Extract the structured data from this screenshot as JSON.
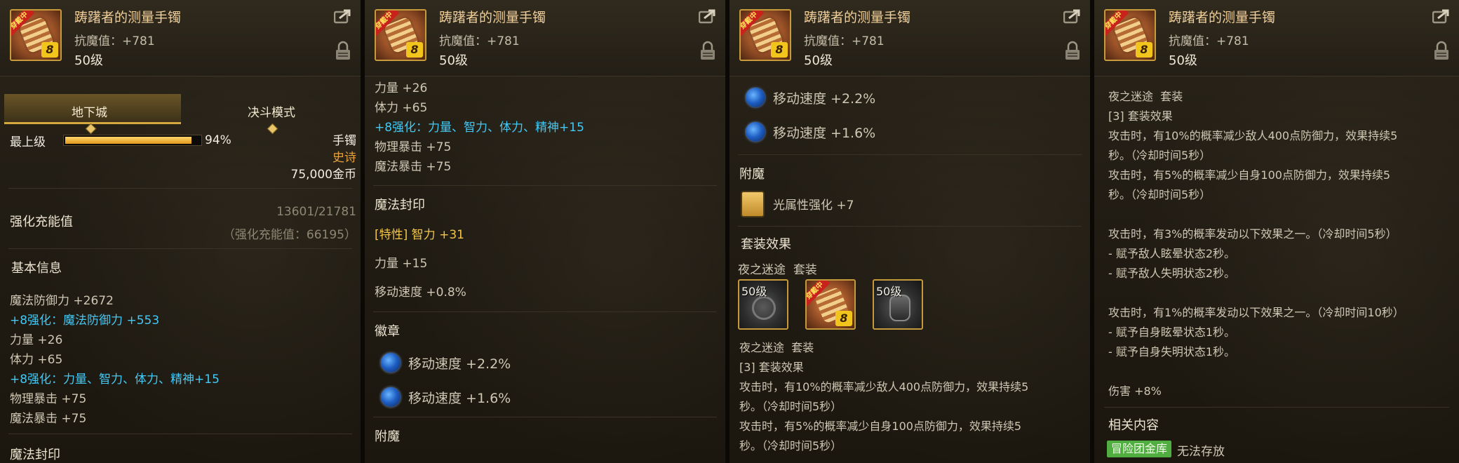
{
  "colors": {
    "accent": "#d6a93f",
    "cyan": "#44c8f4",
    "gold": "#f1c64a",
    "orange": "#e7a23d",
    "badge": "#4fae3f"
  },
  "item": {
    "name": "踌躇者的测量手镯",
    "resist": "抗魔值：+781",
    "level": "50级",
    "ribbon": "穿戴中",
    "enhance": "8",
    "icon": "bracer-icon"
  },
  "p1": {
    "tabs": [
      "地下城",
      "决斗模式"
    ],
    "grade_label": "最上级",
    "grade_percent": 94,
    "grade_percent_text": "94%",
    "type": "手镯",
    "rarity": "史诗",
    "price": "75,000金币",
    "charge_label": "强化充能值",
    "charge_value": "13601/21781",
    "charge_note": "（强化充能值：66195）",
    "basic_title": "基本信息",
    "stats": [
      "魔法防御力 +2672",
      "+8强化：魔法防御力 +553",
      "力量 +26",
      "体力 +65",
      "+8强化：力量、智力、体力、精神+15",
      "物理暴击 +75",
      "魔法暴击 +75"
    ],
    "cut_title": "魔法封印"
  },
  "p2": {
    "stats": [
      "力量 +26",
      "体力 +65",
      "+8强化：力量、智力、体力、精神+15",
      "物理暴击 +75",
      "魔法暴击 +75"
    ],
    "seal_title": "魔法封印",
    "seal_special": "[特性] 智力 +31",
    "seal_lines": [
      "力量 +15",
      "移动速度 +0.8%"
    ],
    "emblem_title": "徽章",
    "emblems": [
      "移动速度 +2.2%",
      "移动速度 +1.6%"
    ],
    "enchant_title": "附魔"
  },
  "p3": {
    "emblems": [
      "移动速度 +2.2%",
      "移动速度 +1.6%"
    ],
    "enchant_title": "附魔",
    "enchant": "光属性强化 +7",
    "set_title": "套装效果",
    "set_name": "夜之迷途",
    "set_suffix": "套装",
    "slots": [
      {
        "level": "50级",
        "icon": "gear-icon"
      },
      {
        "level": "",
        "icon": "bracer-icon"
      },
      {
        "level": "50级",
        "icon": "gauntlet-icon"
      }
    ],
    "set_name2": "夜之迷途",
    "set_suffix2": "套装",
    "set_count": "[3] 套装效果",
    "lines": [
      "攻击时，有10%的概率减少敌人400点防御力，效果持续5",
      "秒。（冷却时间5秒）",
      "攻击时，有5%的概率减少自身100点防御力，效果持续5",
      "秒。（冷却时间5秒）"
    ]
  },
  "p4": {
    "set_name": "夜之迷途",
    "set_suffix": "套装",
    "set_count": "[3] 套装效果",
    "lines": [
      "攻击时，有10%的概率减少敌人400点防御力，效果持续5",
      "秒。（冷却时间5秒）",
      "攻击时，有5%的概率减少自身100点防御力，效果持续5",
      "秒。（冷却时间5秒）"
    ],
    "lines2": [
      "攻击时，有3%的概率发动以下效果之一。（冷却时间5秒）",
      "- 赋予敌人眩晕状态2秒。",
      "- 赋予敌人失明状态2秒。"
    ],
    "lines3": [
      "攻击时，有1%的概率发动以下效果之一。（冷却时间10秒）",
      "- 赋予自身眩晕状态1秒。",
      "- 赋予自身失明状态1秒。"
    ],
    "damage": "伤害 +8%",
    "related_title": "相关内容",
    "related_badge": "冒险团金库",
    "related_note": "无法存放"
  }
}
